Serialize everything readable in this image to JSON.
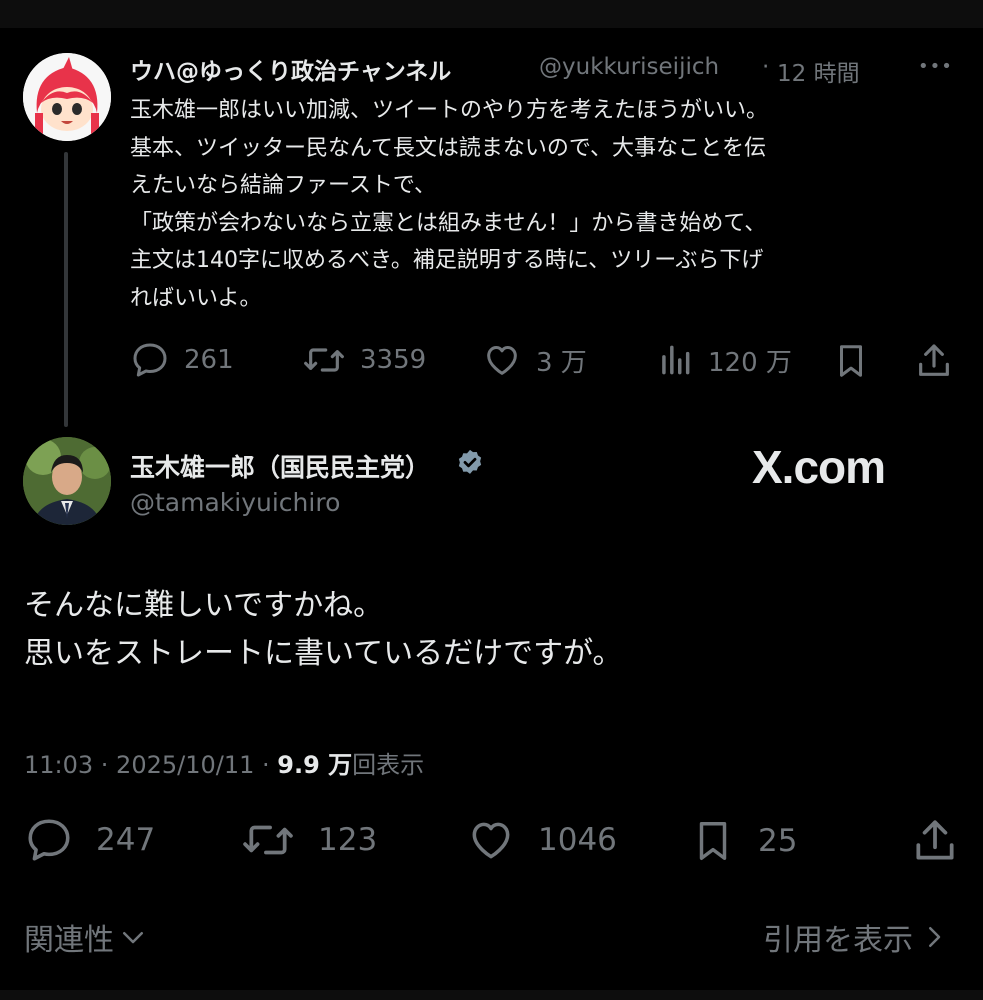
{
  "quoted_tweet": {
    "display_name": "ウハ@ゆっくり政治チャンネル",
    "handle": "@yukkuriseijich",
    "separator": "·",
    "time": "12 時間",
    "more": "•••",
    "lines": [
      "玉木雄一郎はいい加減、ツイートのやり方を考えたほうがいい。",
      "基本、ツイッター民なんて長文は読まないので、大事なことを伝",
      "えたいなら結論ファーストで、",
      "「政策が会わないなら立憲とは組みません！」から書き始めて、",
      "主文は140字に収めるべき。補足説明する時に、ツリーぶら下げ",
      "ればいいよ。"
    ],
    "metrics": {
      "replies": "261",
      "reposts": "3359",
      "likes": "3 万",
      "views": "120 万"
    }
  },
  "main_tweet": {
    "display_name": "玉木雄一郎（国民民主党）",
    "handle": "@tamakiyuichiro",
    "watermark": "X.com",
    "lines": [
      "そんなに難しいですかね。",
      "思いをストレートに書いているだけですが。"
    ],
    "timestamp": "11:03 · 2025/10/11 · ",
    "view_count": "9.9 万",
    "view_label": "回表示",
    "metrics": {
      "replies": "247",
      "reposts": "123",
      "likes": "1046",
      "bookmarks": "25"
    }
  },
  "footer": {
    "relevance_label": "関連性",
    "quotes_label": "引用を表示"
  },
  "colors": {
    "background": "#000000",
    "text": "#e7e9ea",
    "muted": "#71767b",
    "verified_badge": "#829aab"
  }
}
